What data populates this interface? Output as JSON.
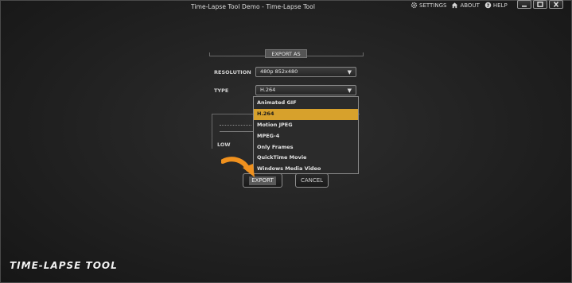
{
  "window": {
    "title": "Time-Lapse Tool Demo - Time-Lapse Tool"
  },
  "top_links": {
    "settings": {
      "label": "SETTINGS",
      "icon": "gear-icon"
    },
    "about": {
      "label": "ABOUT",
      "icon": "home-icon"
    },
    "help": {
      "label": "HELP",
      "icon": "help-icon"
    }
  },
  "window_controls": [
    "minimize-icon",
    "maximize-icon",
    "close-icon"
  ],
  "export_section": {
    "label": "EXPORT AS",
    "resolution": {
      "label": "RESOLUTION",
      "value": "480p 852x480"
    },
    "type": {
      "label": "TYPE",
      "value": "H.264"
    },
    "type_options": [
      {
        "label": "Animated GIF",
        "selected": false
      },
      {
        "label": "H.264",
        "selected": true
      },
      {
        "label": "Motion JPEG",
        "selected": false
      },
      {
        "label": "MPEG-4",
        "selected": false
      },
      {
        "label": "Only Frames",
        "selected": false
      },
      {
        "label": "QuickTime Movie",
        "selected": false
      },
      {
        "label": "Windows Media Video",
        "selected": false
      }
    ],
    "quality_low_label": "LOW"
  },
  "buttons": {
    "export": "EXPORT",
    "cancel": "CANCEL"
  },
  "logo": "TIME-LAPSE TOOL",
  "colors": {
    "accent": "#d7a12c",
    "pointer_arrow": "#f0911e",
    "background": "#1c1c1c"
  }
}
